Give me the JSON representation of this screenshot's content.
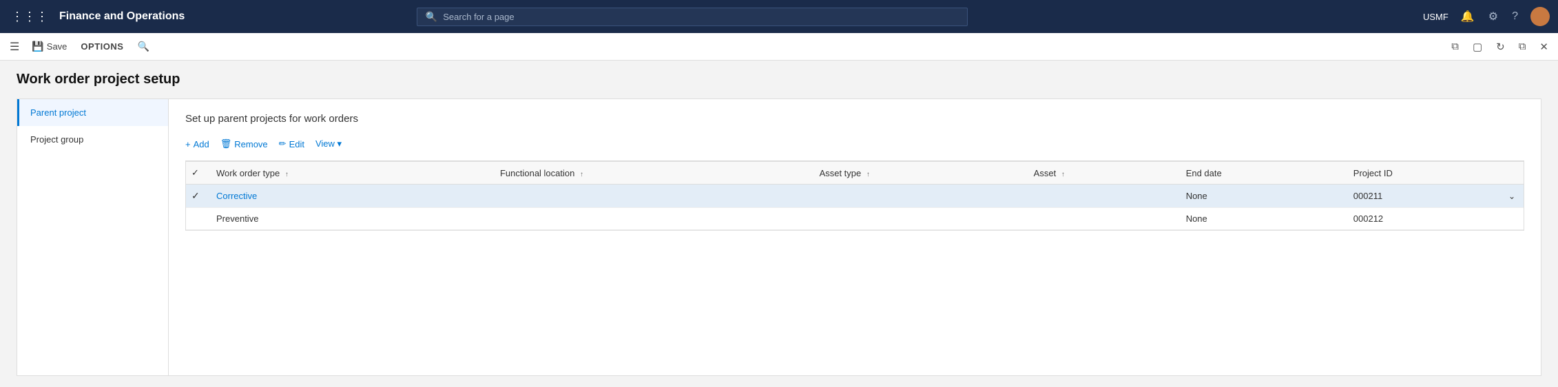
{
  "topNav": {
    "appTitle": "Finance and Operations",
    "searchPlaceholder": "Search for a page",
    "userLabel": "USMF"
  },
  "toolbar": {
    "saveLabel": "Save",
    "optionsLabel": "OPTIONS"
  },
  "page": {
    "title": "Work order project setup"
  },
  "leftNav": {
    "items": [
      {
        "id": "parent-project",
        "label": "Parent project",
        "active": true
      },
      {
        "id": "project-group",
        "label": "Project group",
        "active": false
      }
    ]
  },
  "rightContent": {
    "sectionTitle": "Set up parent projects for work orders",
    "actions": [
      {
        "id": "add",
        "icon": "+",
        "label": "Add"
      },
      {
        "id": "remove",
        "icon": "🗑",
        "label": "Remove"
      },
      {
        "id": "edit",
        "icon": "✏",
        "label": "Edit"
      },
      {
        "id": "view",
        "icon": "",
        "label": "View ▾"
      }
    ],
    "table": {
      "columns": [
        {
          "id": "check",
          "label": "",
          "type": "check"
        },
        {
          "id": "work-order-type",
          "label": "Work order type",
          "sort": true
        },
        {
          "id": "functional-location",
          "label": "Functional location",
          "sort": true
        },
        {
          "id": "asset-type",
          "label": "Asset type",
          "sort": true
        },
        {
          "id": "asset",
          "label": "Asset",
          "sort": true
        },
        {
          "id": "end-date",
          "label": "End date",
          "sort": false
        },
        {
          "id": "project-id",
          "label": "Project ID",
          "sort": false
        }
      ],
      "rows": [
        {
          "selected": true,
          "check": true,
          "workOrderType": "Corrective",
          "workOrderTypeLink": true,
          "functionalLocation": "",
          "assetType": "",
          "asset": "",
          "endDate": "None",
          "projectId": "000211",
          "hasDropdown": true
        },
        {
          "selected": false,
          "check": false,
          "workOrderType": "Preventive",
          "workOrderTypeLink": false,
          "functionalLocation": "",
          "assetType": "",
          "asset": "",
          "endDate": "None",
          "projectId": "000212",
          "hasDropdown": false
        }
      ]
    }
  }
}
